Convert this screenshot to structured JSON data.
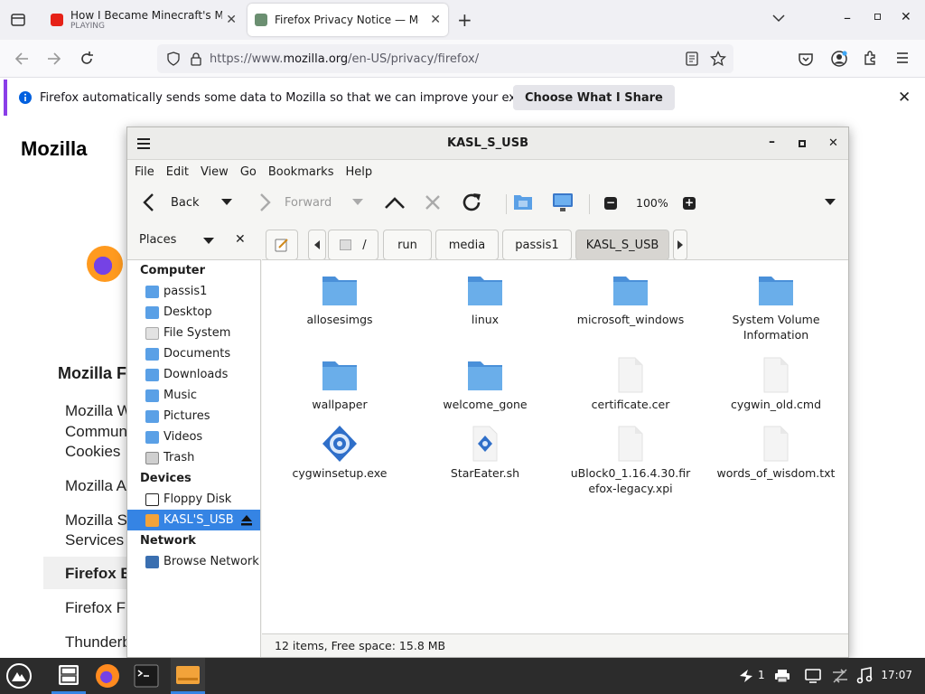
{
  "browser": {
    "tabs": [
      {
        "title": "How I Became Minecraft's MC",
        "subtitle": "PLAYING",
        "active": false
      },
      {
        "title": "Firefox Privacy Notice — Moz",
        "active": true
      }
    ],
    "url_prefix": "https://www.",
    "url_domain": "mozilla.org",
    "url_path": "/en-US/privacy/firefox/",
    "notice_text": "Firefox automatically sends some data to Mozilla so that we can improve your experience.",
    "notice_button": "Choose What I Share"
  },
  "page": {
    "brand": "Mozilla",
    "section_heading": "Mozilla F",
    "items": [
      "Mozilla W",
      "Commun",
      "Cookies",
      "Mozilla A",
      "Mozilla S",
      "Services",
      "Firefox B",
      "Firefox F",
      "Thunderb"
    ]
  },
  "file_manager": {
    "title": "KASL_S_USB",
    "menu": [
      "File",
      "Edit",
      "View",
      "Go",
      "Bookmarks",
      "Help"
    ],
    "toolbar": {
      "back": "Back",
      "forward": "Forward",
      "zoom": "100%"
    },
    "places_label": "Places",
    "breadcrumbs": [
      "/",
      "run",
      "media",
      "passis1",
      "KASL_S_USB"
    ],
    "sidebar": {
      "computer_heading": "Computer",
      "computer_items": [
        "passis1",
        "Desktop",
        "File System",
        "Documents",
        "Downloads",
        "Music",
        "Pictures",
        "Videos",
        "Trash"
      ],
      "devices_heading": "Devices",
      "device_items": [
        "Floppy Disk",
        "KASL'S_USB"
      ],
      "network_heading": "Network",
      "network_items": [
        "Browse Network"
      ]
    },
    "files": [
      {
        "name": "allosesimgs",
        "type": "folder"
      },
      {
        "name": "linux",
        "type": "folder"
      },
      {
        "name": "microsoft_windows",
        "type": "folder"
      },
      {
        "name": "System Volume Information",
        "type": "folder"
      },
      {
        "name": "wallpaper",
        "type": "folder"
      },
      {
        "name": "welcome_gone",
        "type": "folder"
      },
      {
        "name": "certificate.cer",
        "type": "file"
      },
      {
        "name": "cygwin_old.cmd",
        "type": "file"
      },
      {
        "name": "cygwinsetup.exe",
        "type": "exe"
      },
      {
        "name": "StarEater.sh",
        "type": "script"
      },
      {
        "name": "uBlock0_1.16.4.30.firefox-legacy.xpi",
        "type": "file"
      },
      {
        "name": "words_of_wisdom.txt",
        "type": "file"
      }
    ],
    "status": "12 items, Free space: 15.8 MB"
  },
  "taskbar": {
    "notification_count": "1",
    "clock": "17:07"
  },
  "colors": {
    "accent": "#3584e4",
    "folder": "#5aa0e6",
    "notice_bar": "#8a3ee8"
  }
}
